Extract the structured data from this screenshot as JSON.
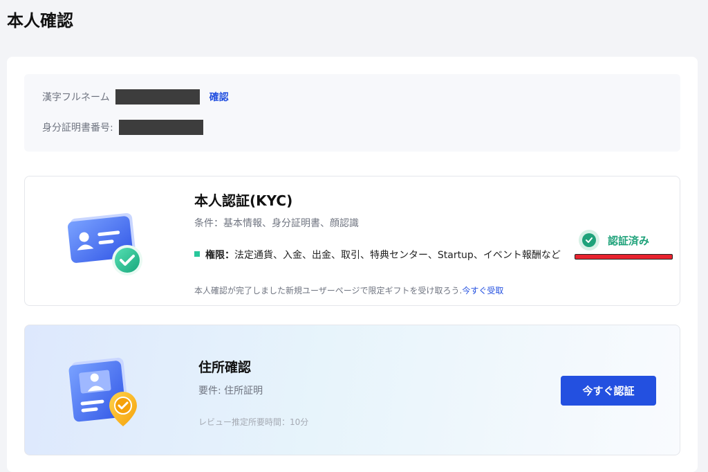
{
  "page": {
    "title": "本人確認"
  },
  "info": {
    "name_label": "漢字フルネーム",
    "confirm_link": "確認",
    "id_label": "身分証明書番号:"
  },
  "kyc": {
    "title": "本人認証(KYC)",
    "condition": "条件：基本情報、身分証明書、顔認識",
    "permission_label": "権限：",
    "permission_text": "法定通貨、入金、出金、取引、特典センター、Startup、イベント報酬など",
    "gift_text": "本人確認が完了しました新規ユーザーページで限定ギフトを受け取ろう.",
    "gift_link": "今すぐ受取",
    "status": "認証済み",
    "colors": {
      "status": "#1fa27a",
      "underline": "#e8232f"
    }
  },
  "address": {
    "title": "住所確認",
    "requirement": "要件: 住所証明",
    "review_time": "レビュー推定所要時間：10分",
    "button": "今すぐ認証",
    "colors": {
      "button": "#2350e0"
    }
  },
  "icons": {
    "kyc_illustration": "id-card-check-icon",
    "address_illustration": "id-card-location-pin-icon",
    "status_icon": "check-circle-icon"
  }
}
